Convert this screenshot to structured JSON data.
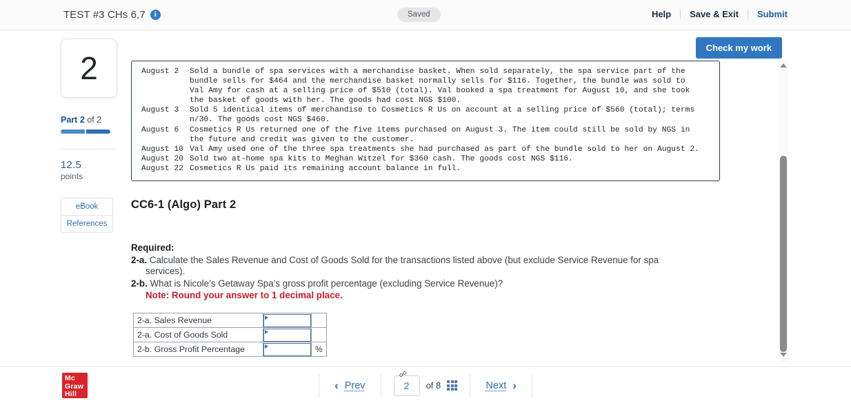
{
  "header": {
    "assignment_title": "TEST #3 CHs 6,7",
    "info_icon": "info-icon",
    "save_status": "Saved",
    "actions": [
      {
        "label": "Help",
        "name": "help-link"
      },
      {
        "label": "Save & Exit",
        "name": "save-and-exit-link"
      },
      {
        "label": "Submit",
        "name": "submit-link"
      }
    ]
  },
  "check_my_work": {
    "label": "Check my work"
  },
  "sidebar": {
    "question_number": "2",
    "part_prefix": "Part",
    "part_current": "2",
    "part_of": "of 2",
    "points_value": "12.5",
    "points_unit": "points",
    "buttons": [
      {
        "label": "eBook",
        "name": "ebook-button"
      },
      {
        "label": "References",
        "name": "references-button"
      }
    ]
  },
  "transactions": [
    {
      "date": "August 2",
      "lines": [
        "Sold a bundle of spa services with a merchandise basket. When sold separately, the spa service part of the",
        "bundle sells for $464 and the merchandise basket normally sells for $116. Together, the bundle was sold to",
        "Val Amy for cash at a selling price of $510 (total). Val booked a spa treatment for August 10, and she took",
        "the basket of goods with her. The goods had cost NGS $100."
      ]
    },
    {
      "date": "August 3",
      "lines": [
        "Sold 5 identical items of merchandise to Cosmetics R Us on account at a selling price of $560 (total); terms",
        "n/30. The goods cost NGS $460."
      ]
    },
    {
      "date": "August 6",
      "lines": [
        "Cosmetics R Us returned one of the five items purchased on August 3. The item could still be sold by NGS in",
        "the future and credit was given to the customer."
      ]
    },
    {
      "date": "August 10",
      "lines": [
        "Val Amy used one of the three spa treatments she had purchased as part of the bundle sold to her on August 2."
      ]
    },
    {
      "date": "August 20",
      "lines": [
        "Sold two at-home spa kits to Meghan Witzel for $360 cash. The goods cost NGS $116."
      ]
    },
    {
      "date": "August 22",
      "lines": [
        "Cosmetics R Us paid its remaining account balance in full."
      ]
    }
  ],
  "question": {
    "title": "CC6-1 (Algo) Part 2",
    "required_heading": "Required:",
    "item_a_number": "2-a.",
    "item_a_text": " Calculate the Sales Revenue and Cost of Goods Sold for the transactions listed above (but exclude Service Revenue for spa",
    "item_a_text_cont": "services).",
    "item_b_number": "2-b.",
    "item_b_text": " What is Nicole’s Getaway Spa’s gross profit percentage (excluding Service Revenue)?",
    "note": "Note: Round your answer to 1 decimal place."
  },
  "answer_table": {
    "rows": [
      {
        "label": "2-a. Sales Revenue",
        "value": "",
        "suffix": ""
      },
      {
        "label": "2-a. Cost of Goods Sold",
        "value": "",
        "suffix": ""
      },
      {
        "label": "2-b. Gross Profit Percentage",
        "value": "",
        "suffix": "%"
      }
    ]
  },
  "footer": {
    "logo_line1": "Mc",
    "logo_line2": "Graw",
    "logo_line3": "Hill",
    "prev_label": "Prev",
    "next_label": "Next",
    "current_page": "2",
    "page_of": "of 8",
    "grid_icon": "grid-icon",
    "chain_icon": "link-icon"
  },
  "colors": {
    "accent_blue": "#3077c0",
    "link_blue": "#2f6fb4",
    "note_red": "#c8202e",
    "logo_red": "#d7252b",
    "box_border": "#2c3e50"
  }
}
